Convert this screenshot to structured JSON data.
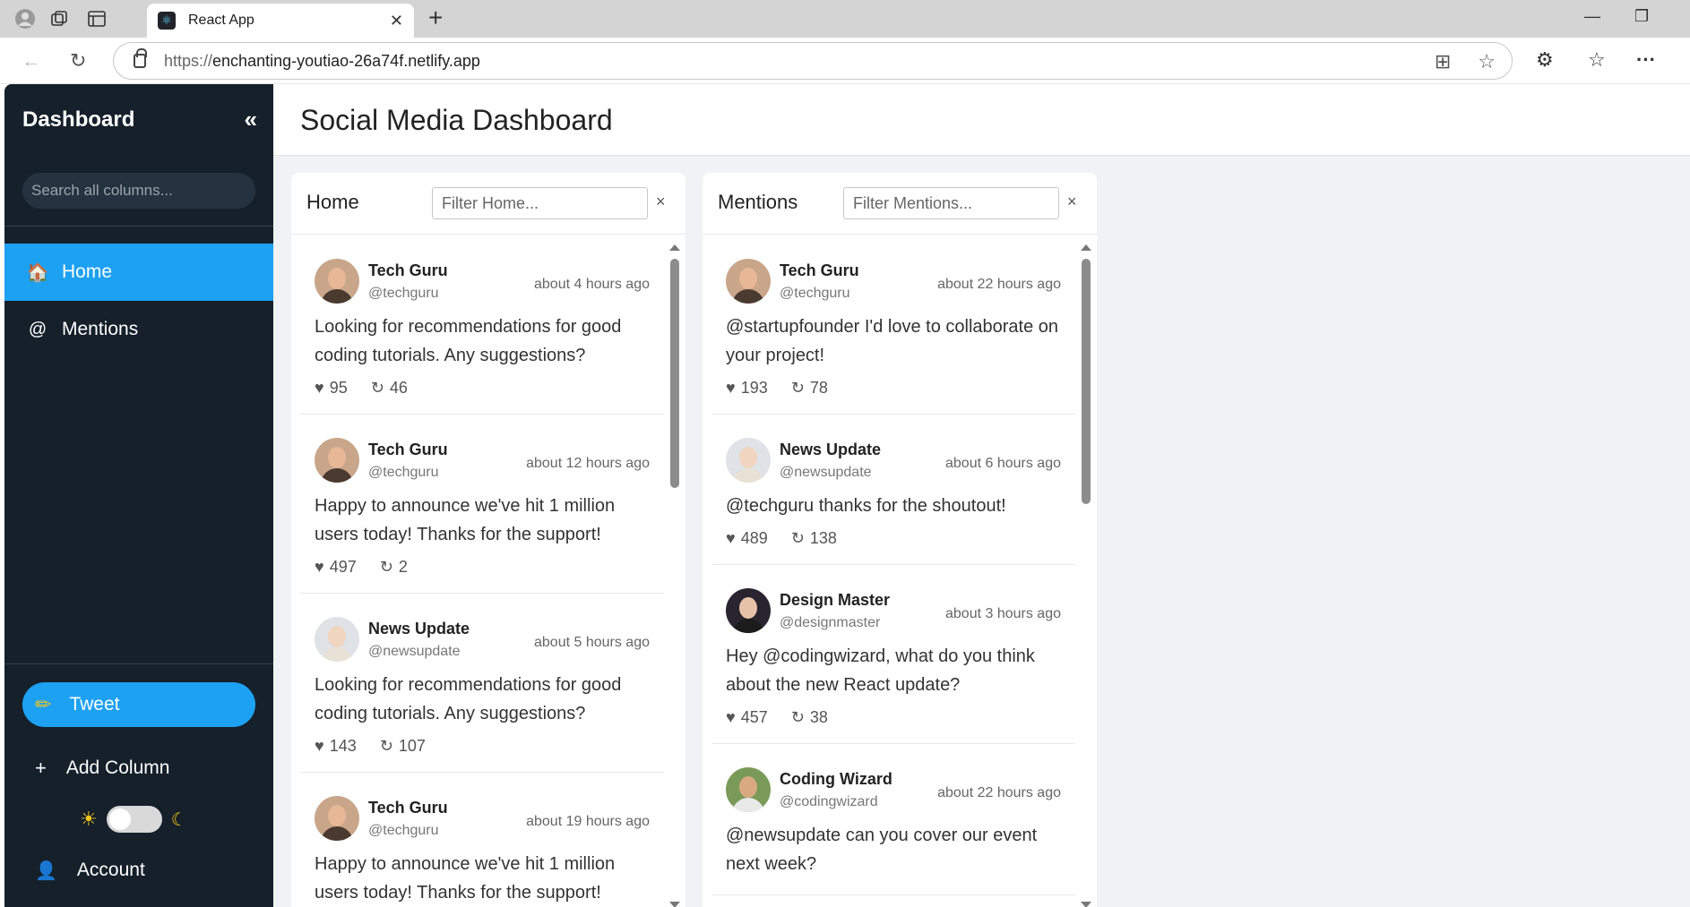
{
  "browser": {
    "tab_title": "React App",
    "url_proto": "https://",
    "url_host": "enchanting-youtiao-26a74f.netlify.app"
  },
  "sidebar": {
    "title": "Dashboard",
    "collapse_glyph": "«",
    "search_placeholder": "Search all columns...",
    "nav": [
      {
        "label": "Home",
        "icon": "home-icon",
        "glyph": "🏠"
      },
      {
        "label": "Mentions",
        "icon": "at-icon",
        "glyph": "@"
      }
    ],
    "tweet_label": "Tweet",
    "tweet_glyph": "✏",
    "add_column_label": "Add Column",
    "add_column_glyph": "+",
    "theme_sun": "☀",
    "theme_moon": "☾",
    "account_label": "Account",
    "account_glyph": "👤"
  },
  "main": {
    "title": "Social Media Dashboard"
  },
  "columns": [
    {
      "title": "Home",
      "filter_placeholder": "Filter Home...",
      "close_glyph": "×",
      "posts": [
        {
          "name": "Tech Guru",
          "handle": "@techguru",
          "time": "about 4 hours ago",
          "text": "Looking for recommendations for good coding tutorials. Any suggestions?",
          "likes": "95",
          "retweets": "46",
          "avatar": "techguru"
        },
        {
          "name": "Tech Guru",
          "handle": "@techguru",
          "time": "about 12 hours ago",
          "text": "Happy to announce we've hit 1 million users today! Thanks for the support!",
          "likes": "497",
          "retweets": "2",
          "avatar": "techguru"
        },
        {
          "name": "News Update",
          "handle": "@newsupdate",
          "time": "about 5 hours ago",
          "text": "Looking for recommendations for good coding tutorials. Any suggestions?",
          "likes": "143",
          "retweets": "107",
          "avatar": "newsupdate"
        },
        {
          "name": "Tech Guru",
          "handle": "@techguru",
          "time": "about 19 hours ago",
          "text": "Happy to announce we've hit 1 million users today! Thanks for the support!",
          "likes": "",
          "retweets": "",
          "avatar": "techguru"
        }
      ]
    },
    {
      "title": "Mentions",
      "filter_placeholder": "Filter Mentions...",
      "close_glyph": "×",
      "posts": [
        {
          "name": "Tech Guru",
          "handle": "@techguru",
          "time": "about 22 hours ago",
          "text": "@startupfounder I'd love to collaborate on your project!",
          "likes": "193",
          "retweets": "78",
          "avatar": "techguru"
        },
        {
          "name": "News Update",
          "handle": "@newsupdate",
          "time": "about 6 hours ago",
          "text": "@techguru thanks for the shoutout!",
          "likes": "489",
          "retweets": "138",
          "avatar": "newsupdate"
        },
        {
          "name": "Design Master",
          "handle": "@designmaster",
          "time": "about 3 hours ago",
          "text": "Hey @codingwizard, what do you think about the new React update?",
          "likes": "457",
          "retweets": "38",
          "avatar": "designmaster"
        },
        {
          "name": "Coding Wizard",
          "handle": "@codingwizard",
          "time": "about 22 hours ago",
          "text": "@newsupdate can you cover our event next week?",
          "likes": "",
          "retweets": "",
          "avatar": "codingwizard"
        }
      ]
    }
  ],
  "icons": {
    "like": "♥",
    "retweet": "↻"
  },
  "colors": {
    "accent": "#1da1f2",
    "sidebar_bg": "#15202b",
    "main_bg": "#f0f2f5"
  }
}
